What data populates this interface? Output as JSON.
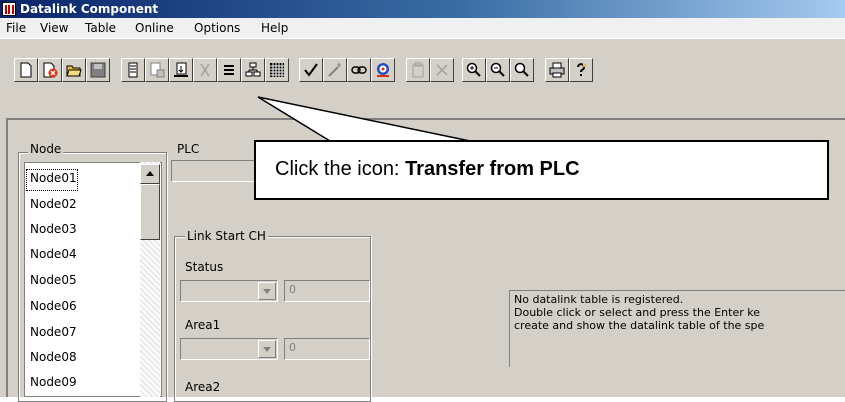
{
  "window": {
    "title": "Datalink Component"
  },
  "menu": [
    "File",
    "View",
    "Table",
    "Online",
    "Options",
    "Help"
  ],
  "toolbar": {
    "buttons": [
      "new-file-icon",
      "delete-file-icon",
      "open-folder-icon",
      "save-disk-icon",
      "plc-icon",
      "print-preview-icon",
      "transfer-from-plc-icon",
      "cut-icon",
      "list-icon",
      "network-icon",
      "grid-icon",
      "check-icon",
      "wand-icon",
      "link-icon",
      "target-icon",
      "paste-icon",
      "delete-x-icon",
      "zoom-in-icon",
      "zoom-out-icon",
      "zoom-icon",
      "print-icon",
      "help-icon"
    ]
  },
  "node_group": {
    "title": "Node",
    "selected": "Node01",
    "items": [
      "Node01",
      "Node02",
      "Node03",
      "Node04",
      "Node05",
      "Node06",
      "Node07",
      "Node08",
      "Node09"
    ]
  },
  "plc_group": {
    "title": "PLC"
  },
  "link_start": {
    "title": "Link Start CH",
    "status_label": "Status",
    "status_value": "0",
    "area1_label": "Area1",
    "area1_value": "0",
    "area2_label": "Area2"
  },
  "message": {
    "line1": "No datalink table is registered.",
    "line2": "Double click or select and press the Enter ke",
    "line3": "create and show the datalink table of the spe"
  },
  "callout": {
    "prefix": "Click the icon: ",
    "emphasis": "Transfer from PLC"
  },
  "colors": {
    "title_bar": "#0a246a",
    "face": "#d4d0c8",
    "delete_red": "#e03010",
    "folder_yellow": "#e8c040"
  }
}
